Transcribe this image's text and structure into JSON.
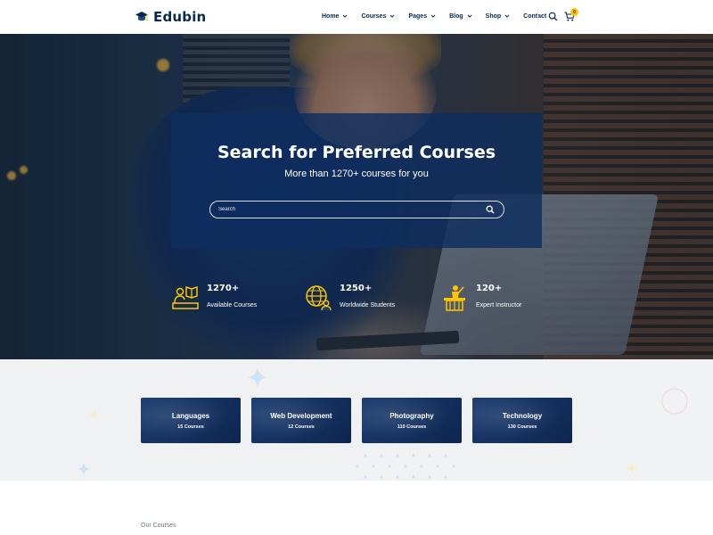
{
  "header": {
    "brand": "Edubin",
    "nav": [
      {
        "label": "Home",
        "has_dropdown": true
      },
      {
        "label": "Courses",
        "has_dropdown": true
      },
      {
        "label": "Pages",
        "has_dropdown": true
      },
      {
        "label": "Blog",
        "has_dropdown": true
      },
      {
        "label": "Shop",
        "has_dropdown": true
      },
      {
        "label": "Contact",
        "has_dropdown": false
      }
    ],
    "cart_count": "0"
  },
  "hero": {
    "title": "Search for Preferred Courses",
    "subtitle": "More than 1270+ courses for you",
    "search_placeholder": "Search",
    "stats": [
      {
        "number": "1270+",
        "label": "Available Courses",
        "icon": "courses-icon"
      },
      {
        "number": "1250+",
        "label": "Worldwide Students",
        "icon": "globe-students-icon"
      },
      {
        "number": "120+",
        "label": "Expert Instructor",
        "icon": "instructor-icon"
      }
    ]
  },
  "categories": [
    {
      "name": "Languages",
      "count": "15 Courses"
    },
    {
      "name": "Web Development",
      "count": "12 Courses"
    },
    {
      "name": "Photography",
      "count": "110 Courses"
    },
    {
      "name": "Technology",
      "count": "130 Courses"
    }
  ],
  "courses_section": {
    "label": "Our Courses"
  },
  "colors": {
    "primary": "#07294d",
    "accent": "#ffc600",
    "panel": "#0e2d5f",
    "section_bg": "#eff1f3"
  }
}
